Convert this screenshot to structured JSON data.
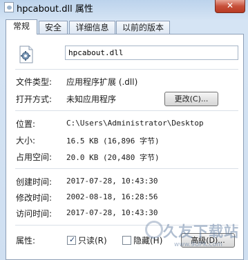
{
  "window": {
    "title": "hpcabout.dll 属性",
    "close_label": "✕"
  },
  "tabs": [
    {
      "label": "常规",
      "active": true
    },
    {
      "label": "安全",
      "active": false
    },
    {
      "label": "详细信息",
      "active": false
    },
    {
      "label": "以前的版本",
      "active": false
    }
  ],
  "general": {
    "file_name": "hpcabout.dll",
    "file_icon": "dll-gear-icon",
    "file_type_label": "文件类型:",
    "file_type_value": "应用程序扩展 (.dll)",
    "open_with_label": "打开方式:",
    "open_with_value": "未知应用程序",
    "change_button": "更改(C)...",
    "location_label": "位置:",
    "location_value": "C:\\Users\\Administrator\\Desktop",
    "size_label": "大小:",
    "size_value": "16.5 KB (16,896 字节)",
    "disk_size_label": "占用空间:",
    "disk_size_value": "20.0 KB (20,480 字节)",
    "created_label": "创建时间:",
    "created_value": "2017-07-28, 10:43:30",
    "modified_label": "修改时间:",
    "modified_value": "2002-08-18, 16:28:56",
    "accessed_label": "访问时间:",
    "accessed_value": "2017-07-28, 10:43:30",
    "attributes_label": "属性:",
    "readonly_label": "只读(R)",
    "readonly_checked": true,
    "hidden_label": "隐藏(H)",
    "hidden_checked": false,
    "advanced_button": "高级(D)..."
  },
  "watermark": {
    "text": "久友下载站",
    "url": "www.9UPK.com"
  },
  "colors": {
    "window_frame": "#c9dbee",
    "close_button": "#c7503a",
    "panel_bg": "#ffffff"
  }
}
